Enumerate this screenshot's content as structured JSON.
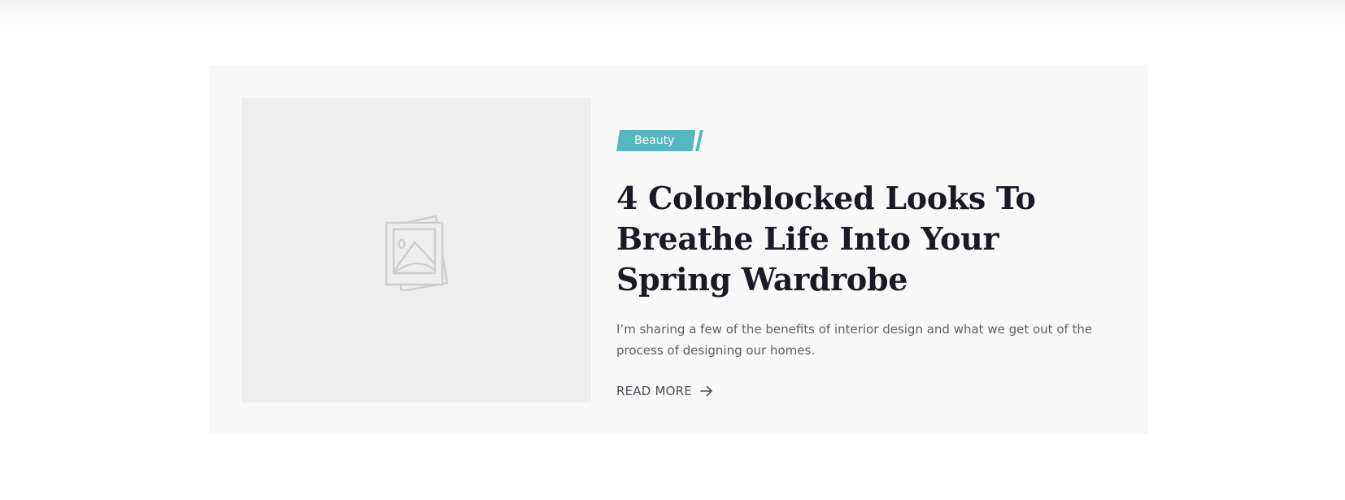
{
  "post": {
    "category": "Beauty",
    "title": "4 Colorblocked Looks To Breathe Life Into Your Spring Wardrobe",
    "excerpt": "I’m sharing a few of the benefits of interior design and what we get out of the process of designing our homes.",
    "read_more_label": "READ MORE",
    "thumbnail_icon": "image-placeholder-icon",
    "read_more_icon": "arrow-right-icon"
  },
  "colors": {
    "accent": "#57b7be",
    "title": "#1b1a24",
    "card_background": "#f9f9f9",
    "thumbnail_background": "#eeeeee"
  }
}
